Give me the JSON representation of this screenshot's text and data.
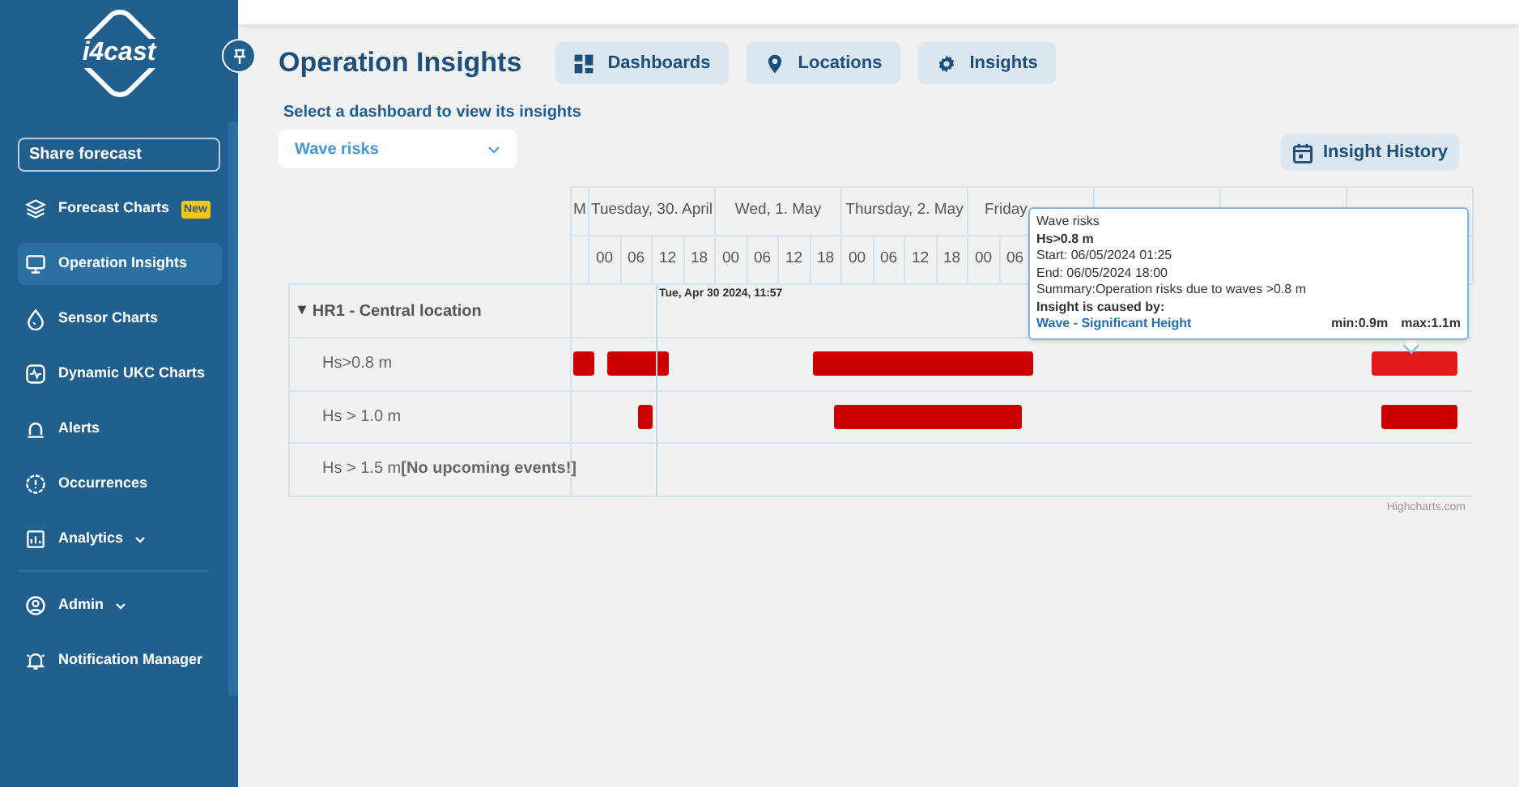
{
  "sidebar": {
    "logo": "i4cast",
    "share_button": "Share forecast",
    "items": [
      {
        "label": "Forecast Charts",
        "badge": "New",
        "selected": false
      },
      {
        "label": "Operation Insights",
        "selected": true
      },
      {
        "label": "Sensor Charts",
        "selected": false
      },
      {
        "label": "Dynamic UKC Charts",
        "selected": false
      },
      {
        "label": "Alerts",
        "selected": false
      },
      {
        "label": "Occurrences",
        "selected": false
      },
      {
        "label": "Analytics",
        "expandable": true,
        "selected": false
      }
    ],
    "bottom_items": [
      {
        "label": "Admin",
        "expandable": true,
        "selected": false
      },
      {
        "label": "Notification Manager",
        "selected": false
      }
    ]
  },
  "page": {
    "title": "Operation Insights",
    "tabs": [
      {
        "label": "Dashboards"
      },
      {
        "label": "Locations"
      },
      {
        "label": "Insights"
      }
    ],
    "select_label": "Select a dashboard to view its insights",
    "dashboard_select": {
      "value": "Wave risks"
    },
    "history_button": "Insight History"
  },
  "timeline": {
    "days": [
      {
        "label": "M"
      },
      {
        "label": "Tuesday, 30. April",
        "hours": [
          "00",
          "06",
          "12",
          "18"
        ]
      },
      {
        "label": "Wed, 1. May",
        "hours": [
          "00",
          "06",
          "12",
          "18"
        ]
      },
      {
        "label": "Thursday, 2. May",
        "hours": [
          "00",
          "06",
          "12",
          "18"
        ]
      },
      {
        "label": "Friday",
        "hours": [
          "00",
          "06"
        ]
      }
    ],
    "now_label": "Tue, Apr 30 2024, 11:57",
    "group_toggle": "▼",
    "group": "HR1 - Central location",
    "rows": [
      {
        "label": "Hs>0.8 m",
        "events": [
          {
            "hovered": false
          },
          {
            "hovered": false
          },
          {
            "hovered": false
          },
          {
            "hovered": true
          }
        ]
      },
      {
        "label": "Hs > 1.0 m",
        "events": [
          {
            "hovered": false
          },
          {
            "hovered": false
          },
          {
            "hovered": false
          }
        ]
      },
      {
        "label": "Hs > 1.5 m",
        "note": "[No upcoming events!]"
      }
    ],
    "credit": "Highcharts.com",
    "tooltip": {
      "title": "Wave risks",
      "name": "Hs>0.8 m",
      "start": "Start: 06/05/2024 01:25",
      "end": "End: 06/05/2024 18:00",
      "summary": "Summary:Operation risks due to waves >0.8 m",
      "cause_label": "Insight is caused by:",
      "cause_link": "Wave - Significant Height",
      "min": "min:0.9m",
      "max": "max:1.1m"
    }
  }
}
